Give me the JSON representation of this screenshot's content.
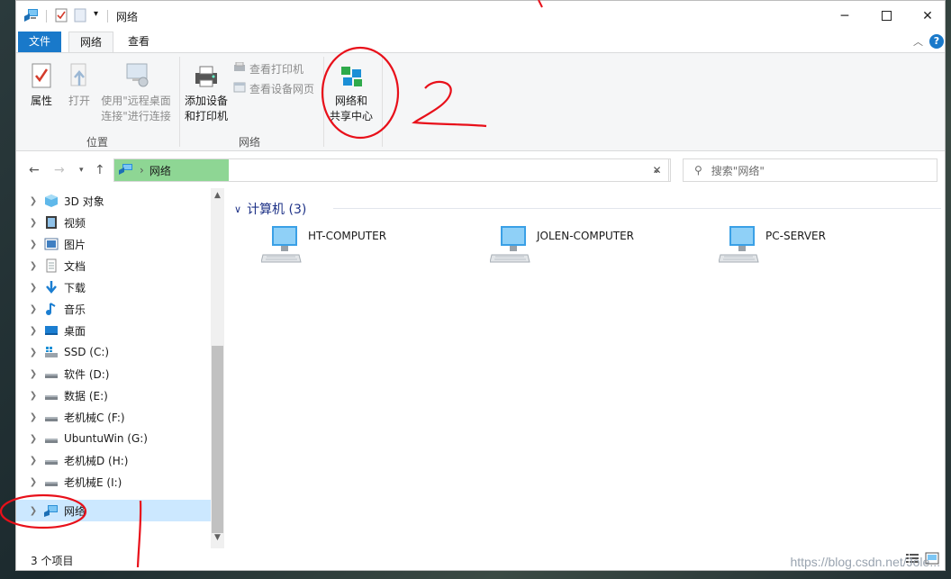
{
  "titlebar": {
    "title": "网络",
    "minimize_icon": "minimize-icon",
    "maximize_icon": "maximize-icon",
    "close_icon": "close-icon"
  },
  "ribbon_tabs": {
    "file": "文件",
    "network": "网络",
    "view": "查看"
  },
  "ribbon": {
    "properties": "属性",
    "open": "打开",
    "remote_line1": "使用\"远程桌面",
    "remote_line2": "连接\"进行连接",
    "group_location": "位置",
    "add_device_line1": "添加设备",
    "add_device_line2": "和打印机",
    "view_printers": "查看打印机",
    "view_device_page": "查看设备网页",
    "network_center_line1": "网络和",
    "network_center_line2": "共享中心",
    "group_network": "网络"
  },
  "address": {
    "crumb": "网络",
    "search_placeholder": "搜索\"网络\""
  },
  "nav": {
    "items": [
      {
        "label": "3D 对象",
        "icon": "3d-objects-icon"
      },
      {
        "label": "视频",
        "icon": "video-icon"
      },
      {
        "label": "图片",
        "icon": "pictures-icon"
      },
      {
        "label": "文档",
        "icon": "documents-icon"
      },
      {
        "label": "下载",
        "icon": "download-icon"
      },
      {
        "label": "音乐",
        "icon": "music-icon"
      },
      {
        "label": "桌面",
        "icon": "desktop-icon"
      },
      {
        "label": "SSD (C:)",
        "icon": "system-drive-icon"
      },
      {
        "label": "软件 (D:)",
        "icon": "drive-icon"
      },
      {
        "label": "数据 (E:)",
        "icon": "drive-icon"
      },
      {
        "label": "老机械C (F:)",
        "icon": "drive-icon"
      },
      {
        "label": "UbuntuWin (G:)",
        "icon": "drive-icon"
      },
      {
        "label": "老机械D (H:)",
        "icon": "drive-icon"
      },
      {
        "label": "老机械E (I:)",
        "icon": "drive-icon"
      },
      {
        "label": "网络",
        "icon": "network-icon"
      }
    ]
  },
  "content": {
    "group_header": "计算机 (3)",
    "computers": [
      "HT-COMPUTER",
      "JOLEN-COMPUTER",
      "PC-SERVER"
    ]
  },
  "statusbar": {
    "count": "3 个项目"
  },
  "annotation": {
    "number": "2"
  },
  "watermark": "https://blog.csdn.net/Jole...",
  "colors": {
    "accent": "#1979ca",
    "highlight_green": "#8ed694",
    "selected": "#cce8ff",
    "annotation_red": "#e8101a"
  }
}
